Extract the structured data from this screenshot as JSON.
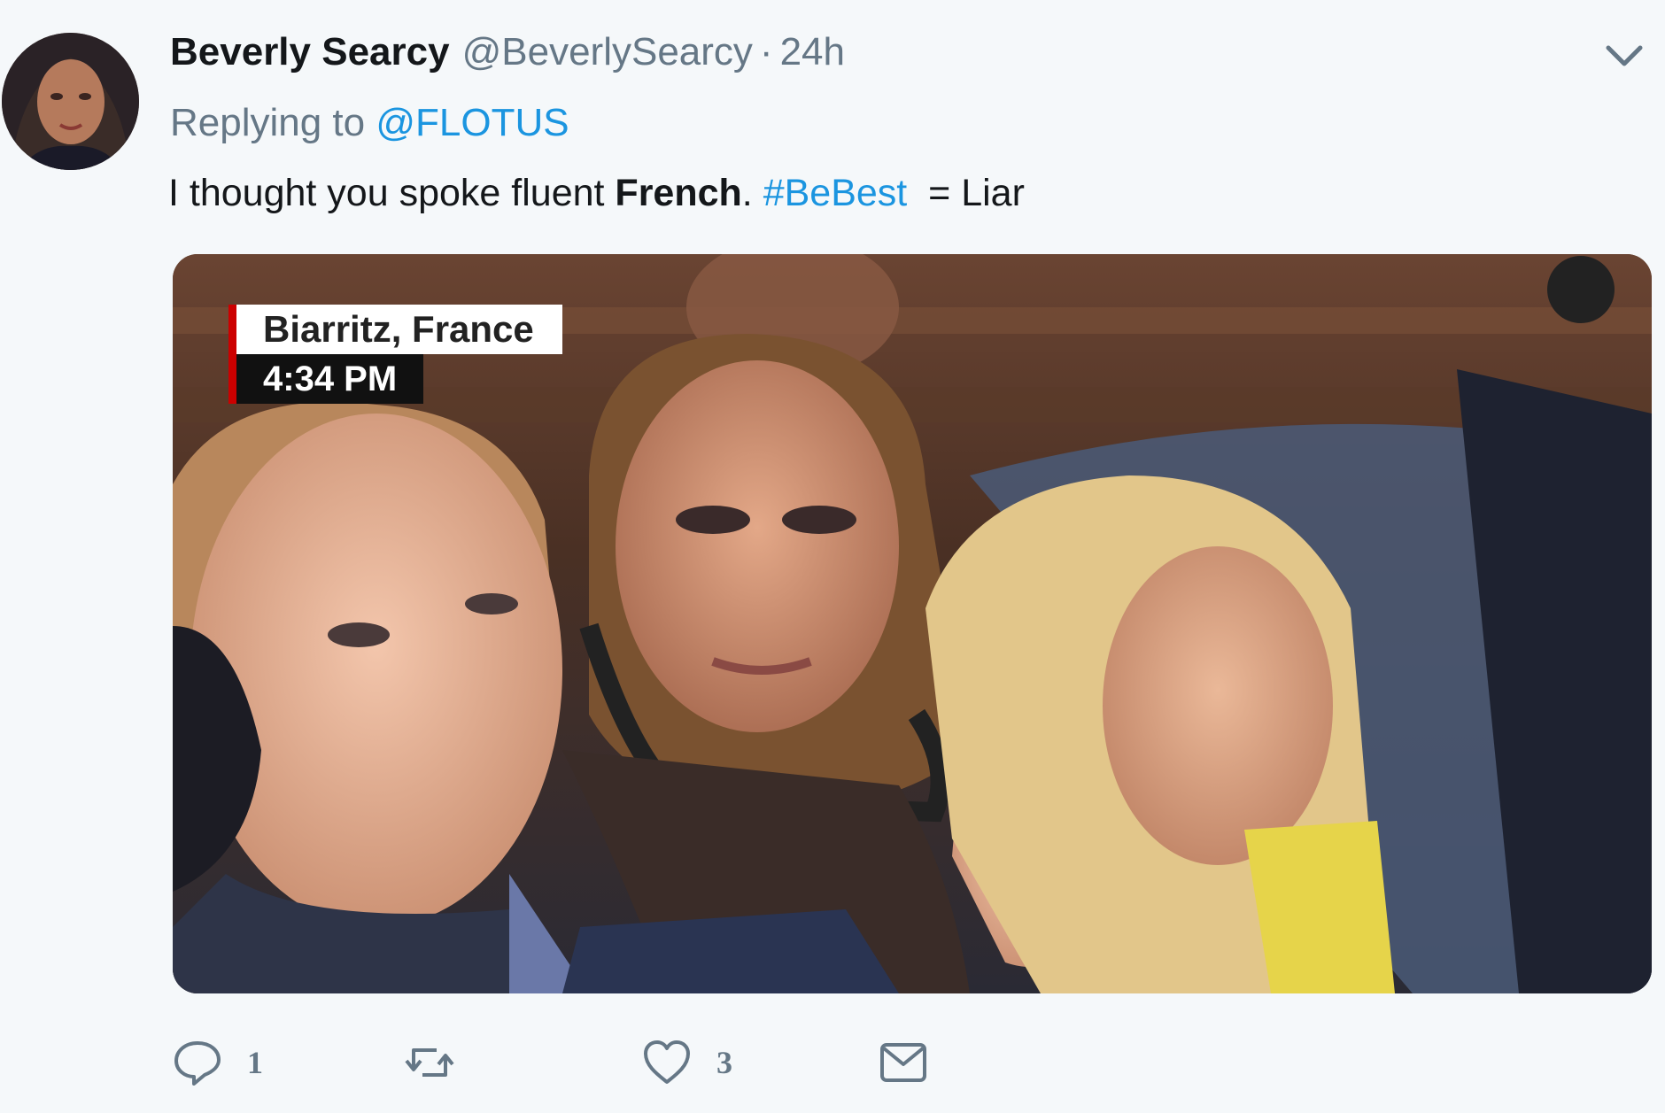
{
  "tweet": {
    "display_name": "Beverly Searcy",
    "handle": "@BeverlySearcy",
    "separator": "·",
    "time": "24h",
    "replying_prefix": "Replying to",
    "replying_to": "@FLOTUS",
    "text_before": "I thought you spoke fluent ",
    "text_bold": "French",
    "text_period": ". ",
    "hashtag": "#BeBest",
    "text_after": "  = Liar"
  },
  "media": {
    "chyron_location": "Biarritz, France",
    "chyron_time": "4:34 PM"
  },
  "actions": {
    "reply_count": "1",
    "retweet_count": "",
    "like_count": "3"
  },
  "icons": {
    "reply": "reply-icon",
    "retweet": "retweet-icon",
    "like": "heart-icon",
    "message": "envelope-icon",
    "caret": "chevron-down-icon"
  },
  "colors": {
    "link": "#1b95e0",
    "secondary_text": "#657786",
    "background": "#f5f8fa"
  }
}
